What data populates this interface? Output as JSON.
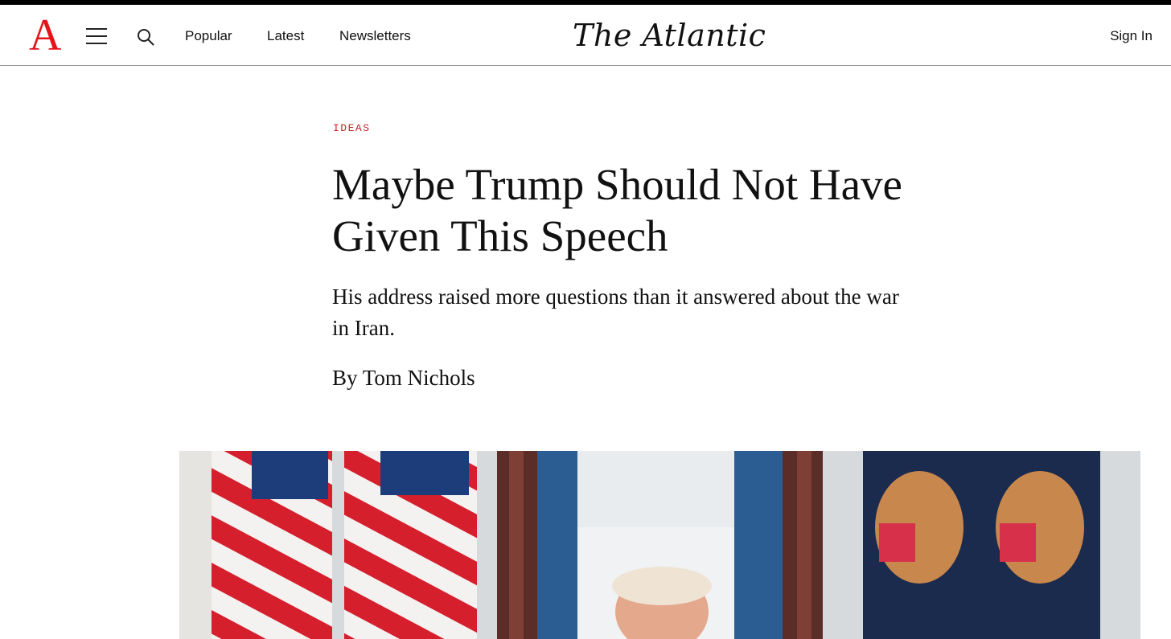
{
  "brand": {
    "logo_letter": "A",
    "title": "The Atlantic",
    "accent_color": "#e7131a"
  },
  "header": {
    "menu_icon": "hamburger-menu-icon",
    "search_icon": "search-icon",
    "nav": [
      "Popular",
      "Latest",
      "Newsletters"
    ],
    "sign_in": "Sign In"
  },
  "article": {
    "section": "IDEAS",
    "headline_line1": "Maybe Trump Should Not Have",
    "headline_line2": "Given This Speech",
    "dek": "His address raised more questions than it answered about the war in Iran.",
    "byline": "By Tom Nichols"
  }
}
